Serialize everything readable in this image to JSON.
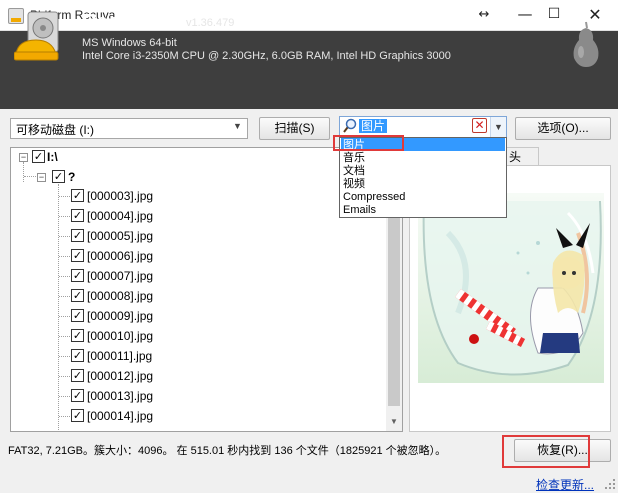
{
  "window": {
    "title": "Piriform Recuva"
  },
  "header": {
    "brand_main": "Recuva",
    "brand_suffix": ".com",
    "version": "v1.36.479",
    "os": "MS Windows 64-bit",
    "hardware": "Intel Core i3-2350M CPU @ 2.30GHz, 6.0GB RAM, Intel HD Graphics 3000"
  },
  "toolbar": {
    "drive": "可移动磁盘 (I:)",
    "scan_label": "扫描(S)",
    "filter_value": "图片",
    "options_label": "选项(O)..."
  },
  "filter_dropdown": {
    "items": [
      "图片",
      "音乐",
      "文档",
      "视频",
      "Compressed",
      "Emails"
    ],
    "selected": "图片"
  },
  "tree": {
    "root": "I:\\",
    "folder": "?",
    "files": [
      "[000003].jpg",
      "[000004].jpg",
      "[000005].jpg",
      "[000006].jpg",
      "[000007].jpg",
      "[000008].jpg",
      "[000009].jpg",
      "[000010].jpg",
      "[000011].jpg",
      "[000012].jpg",
      "[000013].jpg",
      "[000014].jpg"
    ]
  },
  "preview": {
    "tab_fragment": "头"
  },
  "status": {
    "text": "FAT32, 7.21GB。簇大小：4096。 在 515.01 秒内找到 136 个文件（1825921 个被忽略）。",
    "recover_label": "恢复(R)...",
    "update_link": "检查更新..."
  },
  "colors": {
    "header_bg": "#3e3e3e",
    "selection": "#3399ff",
    "highlight": "#e03a3a",
    "link": "#0033bb"
  }
}
